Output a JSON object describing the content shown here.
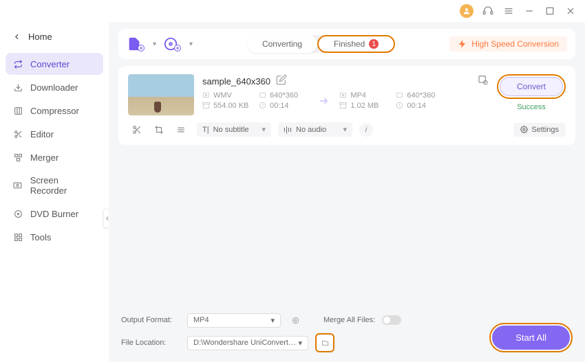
{
  "titlebar": {},
  "home_label": "Home",
  "sidebar": {
    "items": [
      {
        "icon": "converter",
        "label": "Converter"
      },
      {
        "icon": "downloader",
        "label": "Downloader"
      },
      {
        "icon": "compressor",
        "label": "Compressor"
      },
      {
        "icon": "editor",
        "label": "Editor"
      },
      {
        "icon": "merger",
        "label": "Merger"
      },
      {
        "icon": "screen-recorder",
        "label": "Screen Recorder"
      },
      {
        "icon": "dvd-burner",
        "label": "DVD Burner"
      },
      {
        "icon": "tools",
        "label": "Tools"
      }
    ]
  },
  "tabs": {
    "converting": "Converting",
    "finished": "Finished",
    "finished_count": "1"
  },
  "high_speed_label": "High Speed Conversion",
  "file": {
    "name": "sample_640x360",
    "src_format": "WMV",
    "src_res": "640*360",
    "src_size": "554.00 KB",
    "src_dur": "00:14",
    "dst_format": "MP4",
    "dst_res": "640*360",
    "dst_size": "1.02 MB",
    "dst_dur": "00:14"
  },
  "convert_label": "Convert",
  "status_text": "Success",
  "subtitle_dd": "No subtitle",
  "audio_dd": "No audio",
  "settings_label": "Settings",
  "bottom": {
    "output_format_label": "Output Format:",
    "output_format_value": "MP4",
    "merge_label": "Merge All Files:",
    "file_location_label": "File Location:",
    "file_location_value": "D:\\Wondershare UniConverter 1"
  },
  "start_all_label": "Start All"
}
